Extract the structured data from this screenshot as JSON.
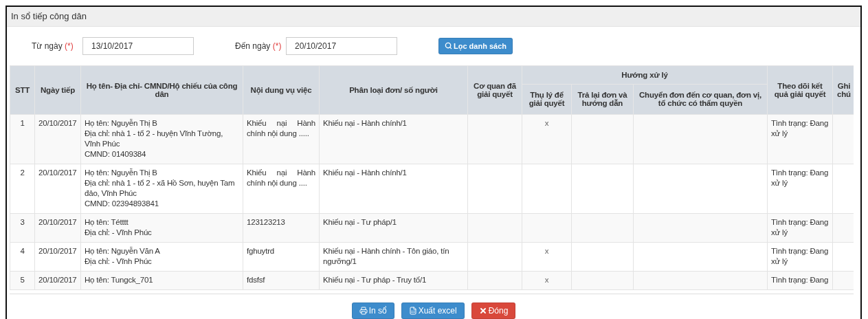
{
  "window": {
    "title": "In sổ tiếp công dân"
  },
  "filters": [
    {
      "label": "Từ ngày",
      "required_mark": "(*)",
      "value": "13/10/2017"
    },
    {
      "label": "Đến ngày",
      "required_mark": "(*)",
      "value": "20/10/2017"
    }
  ],
  "filter_button": "Lọc danh sách",
  "table": {
    "columns": [
      "STT",
      "Ngày tiếp",
      "Họ tên- Địa chỉ- CMND/Hộ chiếu của công dân",
      "Nội dung vụ việc",
      "Phân loại đơn/ số người",
      "Cơ quan đã giải quyết",
      "Hướng xử lý",
      "Theo dõi kết quả giải quyết",
      "Ghi chú"
    ],
    "subcolumns": [
      "Thụ lý để giải quyết",
      "Trả lại đơn và hướng dẫn",
      "Chuyển đơn đến cơ quan, đơn vị, tổ chức có thẩm quyền"
    ],
    "rows": [
      {
        "stt": "1",
        "date": "20/10/2017",
        "citizen": [
          "Họ tên: Nguyễn Thị B",
          "Địa chỉ: nhà 1 - tổ 2 - huyện Vĩnh Tường, Vĩnh Phúc",
          "CMND: 01409384"
        ],
        "content": "Khiếu nại Hành chính nội dung .....",
        "category": "Khiếu nại - Hành chính/1",
        "handled": "x",
        "status": "Tình trạng: Đang xử lý"
      },
      {
        "stt": "2",
        "date": "20/10/2017",
        "citizen": [
          "Họ tên: Nguyễn Thị B",
          "Địa chỉ: nhà 1 - tổ 2 - xã Hồ Sơn, huyện Tam đảo, Vĩnh Phúc",
          "CMND: 02394893841"
        ],
        "content": "Khiếu nại Hành chính nội dung ....",
        "category": "Khiếu nại - Hành chính/1",
        "status": "Tình trạng: Đang xử lý"
      },
      {
        "stt": "3",
        "date": "20/10/2017",
        "citizen": [
          "Họ tên: Tétttt",
          "Địa chỉ: - Vĩnh Phúc"
        ],
        "content": "123123213",
        "category": "Khiếu nại - Tư pháp/1",
        "status": "Tình trạng: Đang xử lý"
      },
      {
        "stt": "4",
        "date": "20/10/2017",
        "citizen": [
          "Họ tên: Nguyễn Văn A",
          "Địa chỉ: - Vĩnh Phúc"
        ],
        "content": "fghuytrd",
        "category": "Khiếu nại - Hành chính - Tôn giáo, tín ngưỡng/1",
        "handled": "x",
        "status": "Tình trạng: Đang xử lý"
      },
      {
        "stt": "5",
        "date": "20/10/2017",
        "citizen": [
          "Họ tên: Tungck_701"
        ],
        "content": "fdsfsf",
        "category": "Khiếu nại - Tư pháp - Truy tố/1",
        "handled": "x",
        "status": "Tình trạng: Đang"
      }
    ]
  },
  "buttons": [
    {
      "kind": "print",
      "label": "In sổ"
    },
    {
      "kind": "excel",
      "label": "Xuất excel"
    },
    {
      "kind": "close",
      "label": "Đóng"
    }
  ]
}
